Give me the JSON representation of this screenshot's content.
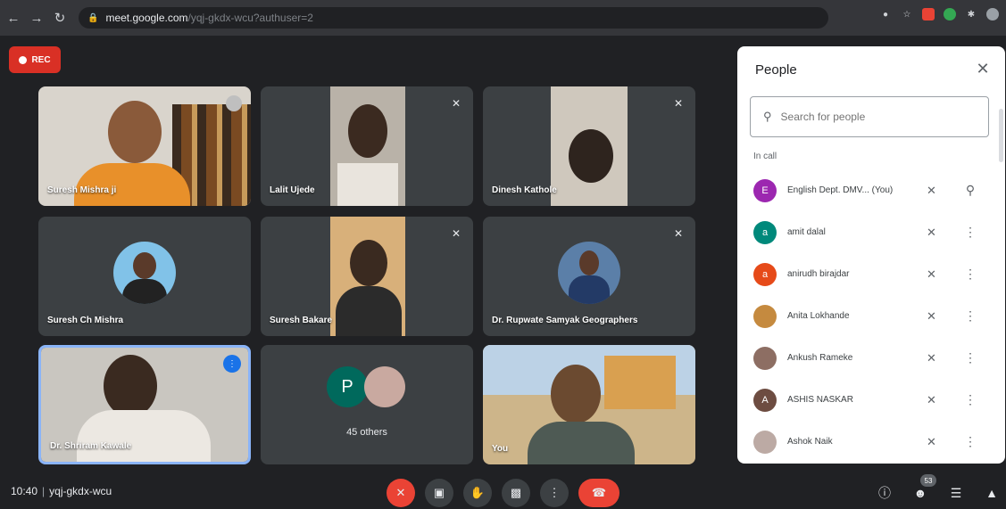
{
  "browser": {
    "url_host": "meet.google.com",
    "url_path": "/yqj-gkdx-wcu?authuser=2",
    "icons": [
      "back-icon",
      "forward-icon",
      "reload-icon",
      "lock-icon",
      "camera-icon",
      "star-icon",
      "extension-icon",
      "profile-icon"
    ]
  },
  "rec": {
    "label": "REC"
  },
  "tiles": [
    {
      "name": "Suresh Mishra ji",
      "muted": false
    },
    {
      "name": "Lalit Ujede",
      "muted": true
    },
    {
      "name": "Dinesh Kathole",
      "muted": true
    },
    {
      "name": "Suresh Ch Mishra",
      "muted": false
    },
    {
      "name": "Suresh Bakare",
      "muted": true
    },
    {
      "name": "Dr. Rupwate Samyak Geographers",
      "muted": true
    },
    {
      "name": "Dr. Shriram Kawale",
      "speaking": true
    },
    {
      "avatar_letter": "P",
      "name": "45 others"
    },
    {
      "name": "You"
    }
  ],
  "panel": {
    "title": "People",
    "search_placeholder": "Search for people",
    "section": "In call",
    "people": [
      {
        "name": "English Dept. DMV...  (You)",
        "avatar": "E",
        "color": "#9c27b0"
      },
      {
        "name": "amit dalal",
        "avatar": "a",
        "color": "#00897b"
      },
      {
        "name": "anirudh birajdar",
        "avatar": "a",
        "color": "#e64a19"
      },
      {
        "name": "Anita Lokhande",
        "avatar": "",
        "color": "#c58a3f"
      },
      {
        "name": "Ankush Rameke",
        "avatar": "",
        "color": "#8d6e63"
      },
      {
        "name": "ASHIS NASKAR",
        "avatar": "A",
        "color": "#6d4c41"
      },
      {
        "name": "Ashok Naik",
        "avatar": "",
        "color": "#bcaaa4"
      }
    ]
  },
  "bottom": {
    "time": "10:40",
    "meeting_code": "yqj-gkdx-wcu",
    "participant_count": "53"
  },
  "colors": {
    "rec": "#d93025",
    "end_call": "#ea4335",
    "active_border": "#8ab4f8"
  }
}
